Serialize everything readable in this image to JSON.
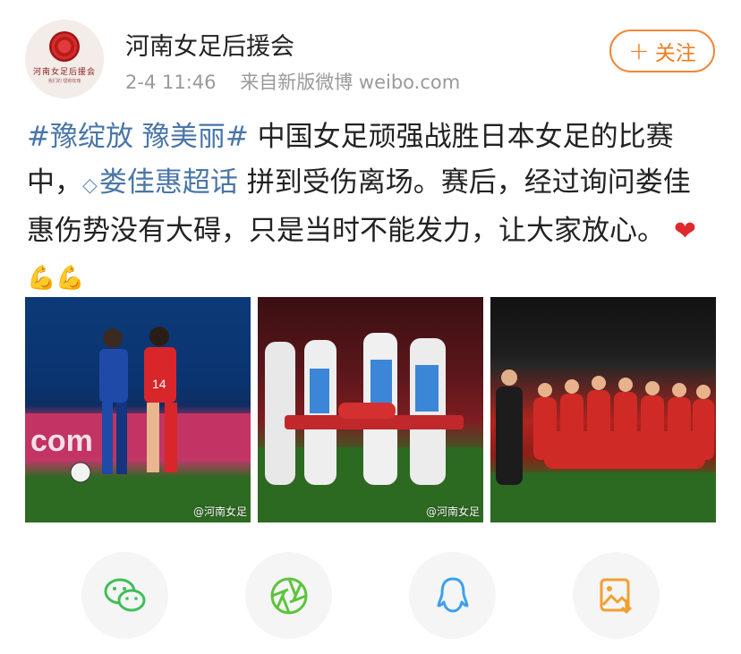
{
  "account": {
    "name": "河南女足后援会",
    "avatar_caption": "河南女足后援会",
    "avatar_subcaption": "我们的  铿锵玫瑰",
    "timestamp": "2-4 11:46",
    "source": "来自新版微博 weibo.com"
  },
  "follow_button": {
    "label": "关注",
    "color": "#f07d1e"
  },
  "post": {
    "hashtag": "#豫绽放 豫美丽#",
    "text_1": " 中国女足顽强战胜日本女足的比赛中，",
    "super_topic": "娄佳惠超话",
    "text_2": " 拼到受伤离场。赛后，经过询问娄佳惠伤势没有大碍，只是当时不能发力，让大家放心。",
    "emojis": [
      "heart",
      "flexed-biceps",
      "flexed-biceps"
    ],
    "link_color": "#4a76a8"
  },
  "photos": [
    {
      "description_name": "photo-match-action",
      "watermark": "@河南女足"
    },
    {
      "description_name": "photo-stretcher",
      "watermark": "@河南女足"
    },
    {
      "description_name": "photo-team-celebration",
      "watermark": ""
    }
  ],
  "share_actions": [
    {
      "icon": "wechat-icon",
      "color": "#3fbf5a"
    },
    {
      "icon": "moments-icon",
      "color": "#5cc43b"
    },
    {
      "icon": "qq-icon",
      "color": "#3aa0f0"
    },
    {
      "icon": "save-image-icon",
      "color": "#f0a030"
    }
  ]
}
